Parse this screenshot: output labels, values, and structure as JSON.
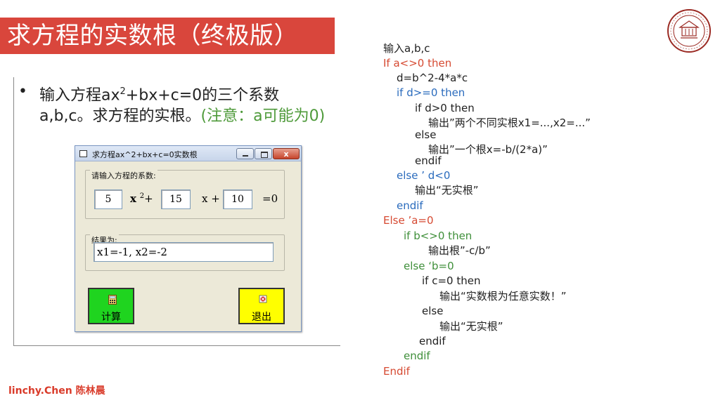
{
  "title": "求方程的实数根（终极版）",
  "bullet": {
    "symbol": "•",
    "line1_pre": "输入方程ax",
    "line1_sup": "2",
    "line1_post": "+bx+c=0的三个系数",
    "line2": "a,b,c。求方程的实根。",
    "note": "(注意：a可能为0)"
  },
  "dialog": {
    "title": "求方程ax^2+bx+c=0实数根",
    "close_label": "x",
    "coef_legend": "请输入方程的系数:",
    "a_value": "5",
    "x2_label": "x",
    "x2_sup": "2",
    "x2_plus": "+",
    "b_value": "15",
    "x_label": "x +",
    "c_value": "10",
    "eq_label": "=0",
    "result_legend": "结果为:",
    "result_value": "x1=-1, x2=-2",
    "calc_label": "计算",
    "exit_label": "退出"
  },
  "code": [
    {
      "text": "输入a,b,c",
      "color": "black"
    },
    {
      "text": "If a<>0 then",
      "color": "red"
    },
    {
      "text": "d=b^2-4*a*c",
      "color": "black"
    },
    {
      "text": "if d>=0 then",
      "color": "blue"
    },
    {
      "text": "if d>0 then",
      "color": "black"
    },
    {
      "text": "输出”两个不同实根x1=...,x2=...”",
      "color": "black"
    },
    {
      "text": "else",
      "color": "black"
    },
    {
      "text": "输出”一个根x=-b/(2*a)”",
      "color": "black"
    },
    {
      "text": "endif",
      "color": "black"
    },
    {
      "text": "else ’ d<0",
      "color": "blue"
    },
    {
      "text": "输出“无实根”",
      "color": "black"
    },
    {
      "text": "endif",
      "color": "blue"
    },
    {
      "text": "Else      ’a=0",
      "color": "red"
    },
    {
      "text": "if b<>0 then",
      "color": "green"
    },
    {
      "text": "输出根”-c/b”",
      "color": "black"
    },
    {
      "text": "else      ‘b=0",
      "color": "green"
    },
    {
      "text": "if c=0 then",
      "color": "black"
    },
    {
      "text": "输出“实数根为任意实数！”",
      "color": "black"
    },
    {
      "text": "else",
      "color": "black"
    },
    {
      "text": "输出“无实根”",
      "color": "black"
    },
    {
      "text": "endif",
      "color": "black"
    },
    {
      "text": "endif",
      "color": "green"
    },
    {
      "text": "Endif",
      "color": "red"
    }
  ],
  "footer": {
    "latin": "linchy.Chen",
    "cn": "陈林晨"
  },
  "colors": {
    "title_bg": "#d9463c",
    "note_green": "#4e9a3a",
    "code_red": "#d64a32",
    "code_blue": "#2a6bbd",
    "code_green": "#3f8f3a",
    "calc_btn": "#1fd41f",
    "exit_btn": "#ffff00"
  }
}
